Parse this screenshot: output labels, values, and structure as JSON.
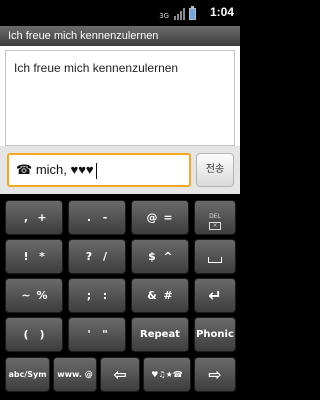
{
  "status_bar": {
    "network_label": "3G",
    "time": "1:04",
    "icons": [
      "signal-icon",
      "battery-icon"
    ]
  },
  "title_bar": {
    "title": "Ich freue mich kennenzulernen"
  },
  "message_area": {
    "text": "Ich freue mich kennenzulernen"
  },
  "input": {
    "prefix_icon": "☎",
    "value": "mich, ♥♥♥",
    "send_label": "전송"
  },
  "keyboard": {
    "row1": [
      {
        "left": ",",
        "right": "+"
      },
      {
        "left": ".",
        "right": "-"
      },
      {
        "left": "@",
        "right": "="
      },
      {
        "caption": "DEL"
      }
    ],
    "row2": [
      {
        "left": "!",
        "right": "*"
      },
      {
        "left": "?",
        "right": "/"
      },
      {
        "left": "$",
        "right": "^"
      }
    ],
    "row3": [
      {
        "left": "~",
        "right": "%"
      },
      {
        "left": ";",
        "right": ":"
      },
      {
        "left": "&",
        "right": "#"
      },
      {
        "icon": "↵"
      }
    ],
    "row4": [
      {
        "left": "(",
        "right": ")"
      },
      {
        "left": "'",
        "right": "\""
      },
      {
        "label": "Repeat"
      },
      {
        "label": "Phonic"
      }
    ],
    "row5": [
      {
        "label": "abc/Sym"
      },
      {
        "label": "www. @"
      },
      {
        "icon": "⇦"
      },
      {
        "label": "♥♫★☎"
      },
      {
        "icon": "⇨"
      }
    ]
  }
}
